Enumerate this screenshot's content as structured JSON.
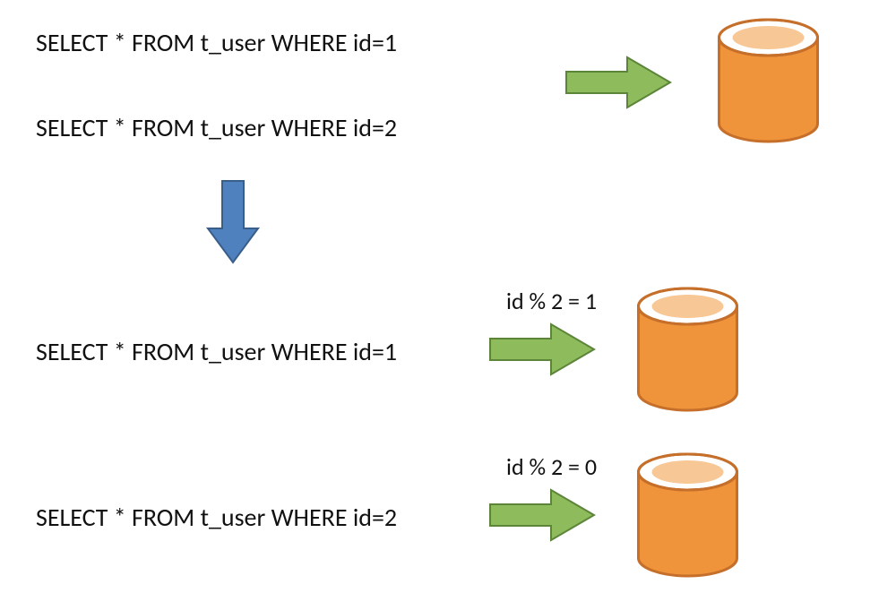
{
  "queries": {
    "q1": "SELECT * FROM t_user WHERE id=1",
    "q2": "SELECT * FROM t_user WHERE id=2",
    "q3": "SELECT * FROM t_user WHERE id=1",
    "q4": "SELECT * FROM t_user WHERE id=2"
  },
  "annotations": {
    "mod1": "id % 2 = 1",
    "mod0": "id % 2 = 0"
  },
  "colors": {
    "green_arrow_fill": "#8ebb5c",
    "green_arrow_stroke": "#5c8539",
    "blue_arrow_fill": "#4e81bd",
    "blue_arrow_stroke": "#3a5e8a",
    "db_fill": "#f0943b",
    "db_stroke": "#c56f2a",
    "db_white": "#ffffff"
  }
}
